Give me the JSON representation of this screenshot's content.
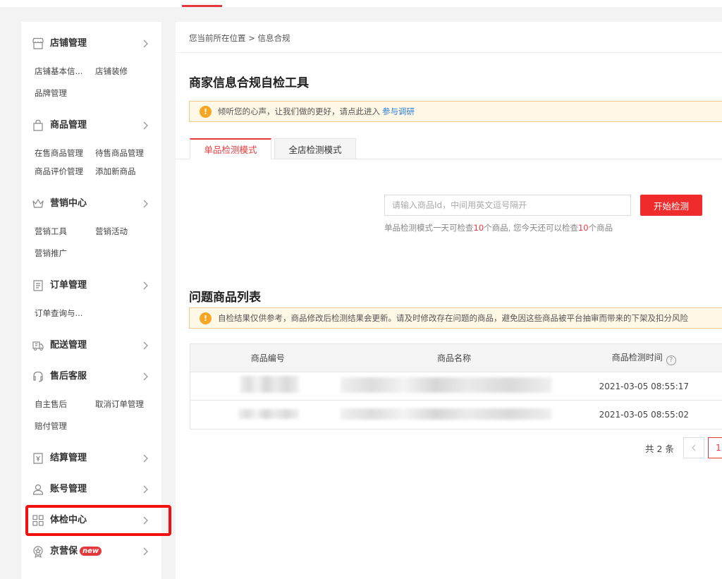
{
  "sidebar": {
    "store": {
      "title": "店铺管理",
      "items": [
        "店铺基本信...",
        "店铺装修",
        "品牌管理"
      ]
    },
    "product": {
      "title": "商品管理",
      "items": [
        "在售商品管理",
        "待售商品管理",
        "商品评价管理",
        "添加新商品"
      ]
    },
    "marketing": {
      "title": "营销中心",
      "items": [
        "营销工具",
        "营销活动",
        "营销推广"
      ]
    },
    "order": {
      "title": "订单管理",
      "items": [
        "订单查询与..."
      ]
    },
    "delivery": {
      "title": "配送管理"
    },
    "aftersale": {
      "title": "售后客服",
      "items": [
        "自主售后",
        "取消订单管理",
        "赔付管理"
      ]
    },
    "settlement": {
      "title": "结算管理"
    },
    "account": {
      "title": "账号管理"
    },
    "health": {
      "title": "体检中心"
    },
    "jyb": {
      "title": "京营保",
      "badge": "new"
    }
  },
  "breadcrumb": {
    "prefix": "您当前所在位置",
    "separator": ">",
    "current": "信息合规"
  },
  "page_title": "商家信息合规自检工具",
  "survey_notice": {
    "text": "倾听您的心声，让我们做的更好，请点此进入",
    "link": "参与调研"
  },
  "tabs": {
    "single": "单品检测模式",
    "store": "全店检测模式"
  },
  "check": {
    "placeholder": "请输入商品Id，中间用英文逗号隔开",
    "button": "开始检测",
    "hint_a": "单品检测模式一天可检查",
    "hint_limit": "10",
    "hint_b": "个商品, 您今天还可以检查",
    "hint_remaining": "10",
    "hint_c": "个商品"
  },
  "problem_list": {
    "title": "问题商品列表",
    "notice": "自检结果仅供参考，商品修改后检测结果会更新。请及时修改存在问题的商品，避免因这些商品被平台抽审而带来的下架及扣分风险",
    "columns": [
      "商品编号",
      "商品名称",
      "商品检测时间"
    ],
    "rows": [
      {
        "time": "2021-03-05 08:55:17"
      },
      {
        "time": "2021-03-05 08:55:02"
      }
    ]
  },
  "pagination": {
    "total": "共 2 条",
    "current": "1"
  },
  "colors": {
    "accent": "#e4393c",
    "link": "#2b7de1",
    "warning": "#f6a623",
    "highlight_box": "#f01010"
  }
}
